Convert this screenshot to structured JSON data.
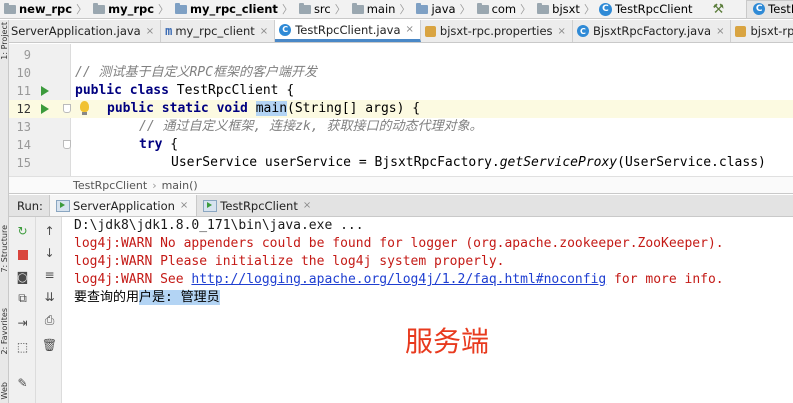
{
  "nav": {
    "crumbs": [
      {
        "label": "new_rpc",
        "icon": "folder-icon",
        "bold": true
      },
      {
        "label": "my_rpc",
        "icon": "folder-icon",
        "bold": true
      },
      {
        "label": "my_rpc_client",
        "icon": "folder-icon",
        "bold": true
      },
      {
        "label": "src",
        "icon": "folder-icon",
        "bold": false
      },
      {
        "label": "main",
        "icon": "folder-icon",
        "bold": false
      },
      {
        "label": "java",
        "icon": "folder-icon",
        "bold": false
      },
      {
        "label": "com",
        "icon": "folder-icon",
        "bold": false
      },
      {
        "label": "bjsxt",
        "icon": "folder-icon",
        "bold": false
      },
      {
        "label": "TestRpcClient",
        "icon": "class-icon",
        "bold": false
      }
    ],
    "run_config": "TestRpcClient"
  },
  "left_stripe": {
    "project": "1: Project",
    "structure": "7: Structure",
    "favorites": "2: Favorites",
    "web": "Web"
  },
  "tabs": [
    {
      "label": "ServerApplication.java",
      "icon": "class-icon",
      "active": false
    },
    {
      "label": "my_rpc_client",
      "icon": "module-icon",
      "active": false
    },
    {
      "label": "TestRpcClient.java",
      "icon": "class-icon",
      "active": true
    },
    {
      "label": "bjsxt-rpc.properties",
      "icon": "properties-icon",
      "active": false
    },
    {
      "label": "BjsxtRpcFactory.java",
      "icon": "class-icon",
      "active": false
    },
    {
      "label": "bjsxt-rpc.properties",
      "icon": "properties-icon",
      "active": false
    }
  ],
  "editor": {
    "line_numbers": [
      "9",
      "10",
      "11",
      "12",
      "13",
      "14",
      "15"
    ],
    "lines": {
      "l10": "// 测试基于自定义RPC框架的客户端开发",
      "l11_kw": "public class",
      "l11_rest": " TestRpcClient {",
      "l12_kw": "public static void",
      "l12_method": "main",
      "l12_rest": "(String[] args) {",
      "l13": "// 通过自定义框架, 连接zk, 获取接口的动态代理对象。",
      "l14_kw": "try",
      "l14_rest": " {",
      "l15_a": "UserService userService = BjsxtRpcFactory.",
      "l15_method": "getServiceProxy",
      "l15_b": "(UserService.class)"
    },
    "breadcrumb": [
      "TestRpcClient",
      "main()"
    ]
  },
  "run": {
    "label": "Run:",
    "tabs": [
      {
        "label": "ServerApplication",
        "active": true
      },
      {
        "label": "TestRpcClient",
        "active": false
      }
    ],
    "console": {
      "cmd": "D:\\jdk8\\jdk1.8.0_171\\bin\\java.exe ...",
      "warn1": "log4j:WARN No appenders could be found for logger (org.apache.zookeeper.ZooKeeper).",
      "warn2": "log4j:WARN Please initialize the log4j system properly.",
      "warn3_pre": "log4j:WARN See ",
      "warn3_link": "http://logging.apache.org/log4j/1.2/faq.html#noconfig",
      "warn3_post": " for more info.",
      "out_a": "要查询的用",
      "out_sel": "户是: 管理员"
    }
  },
  "overlay_label": "服务端",
  "colors": {
    "keyword": "#000080",
    "comment": "#808080",
    "warn": "#c41a16",
    "link": "#1f3fd1",
    "selection": "#b3d4f4",
    "overlay": "#e83a1e"
  }
}
